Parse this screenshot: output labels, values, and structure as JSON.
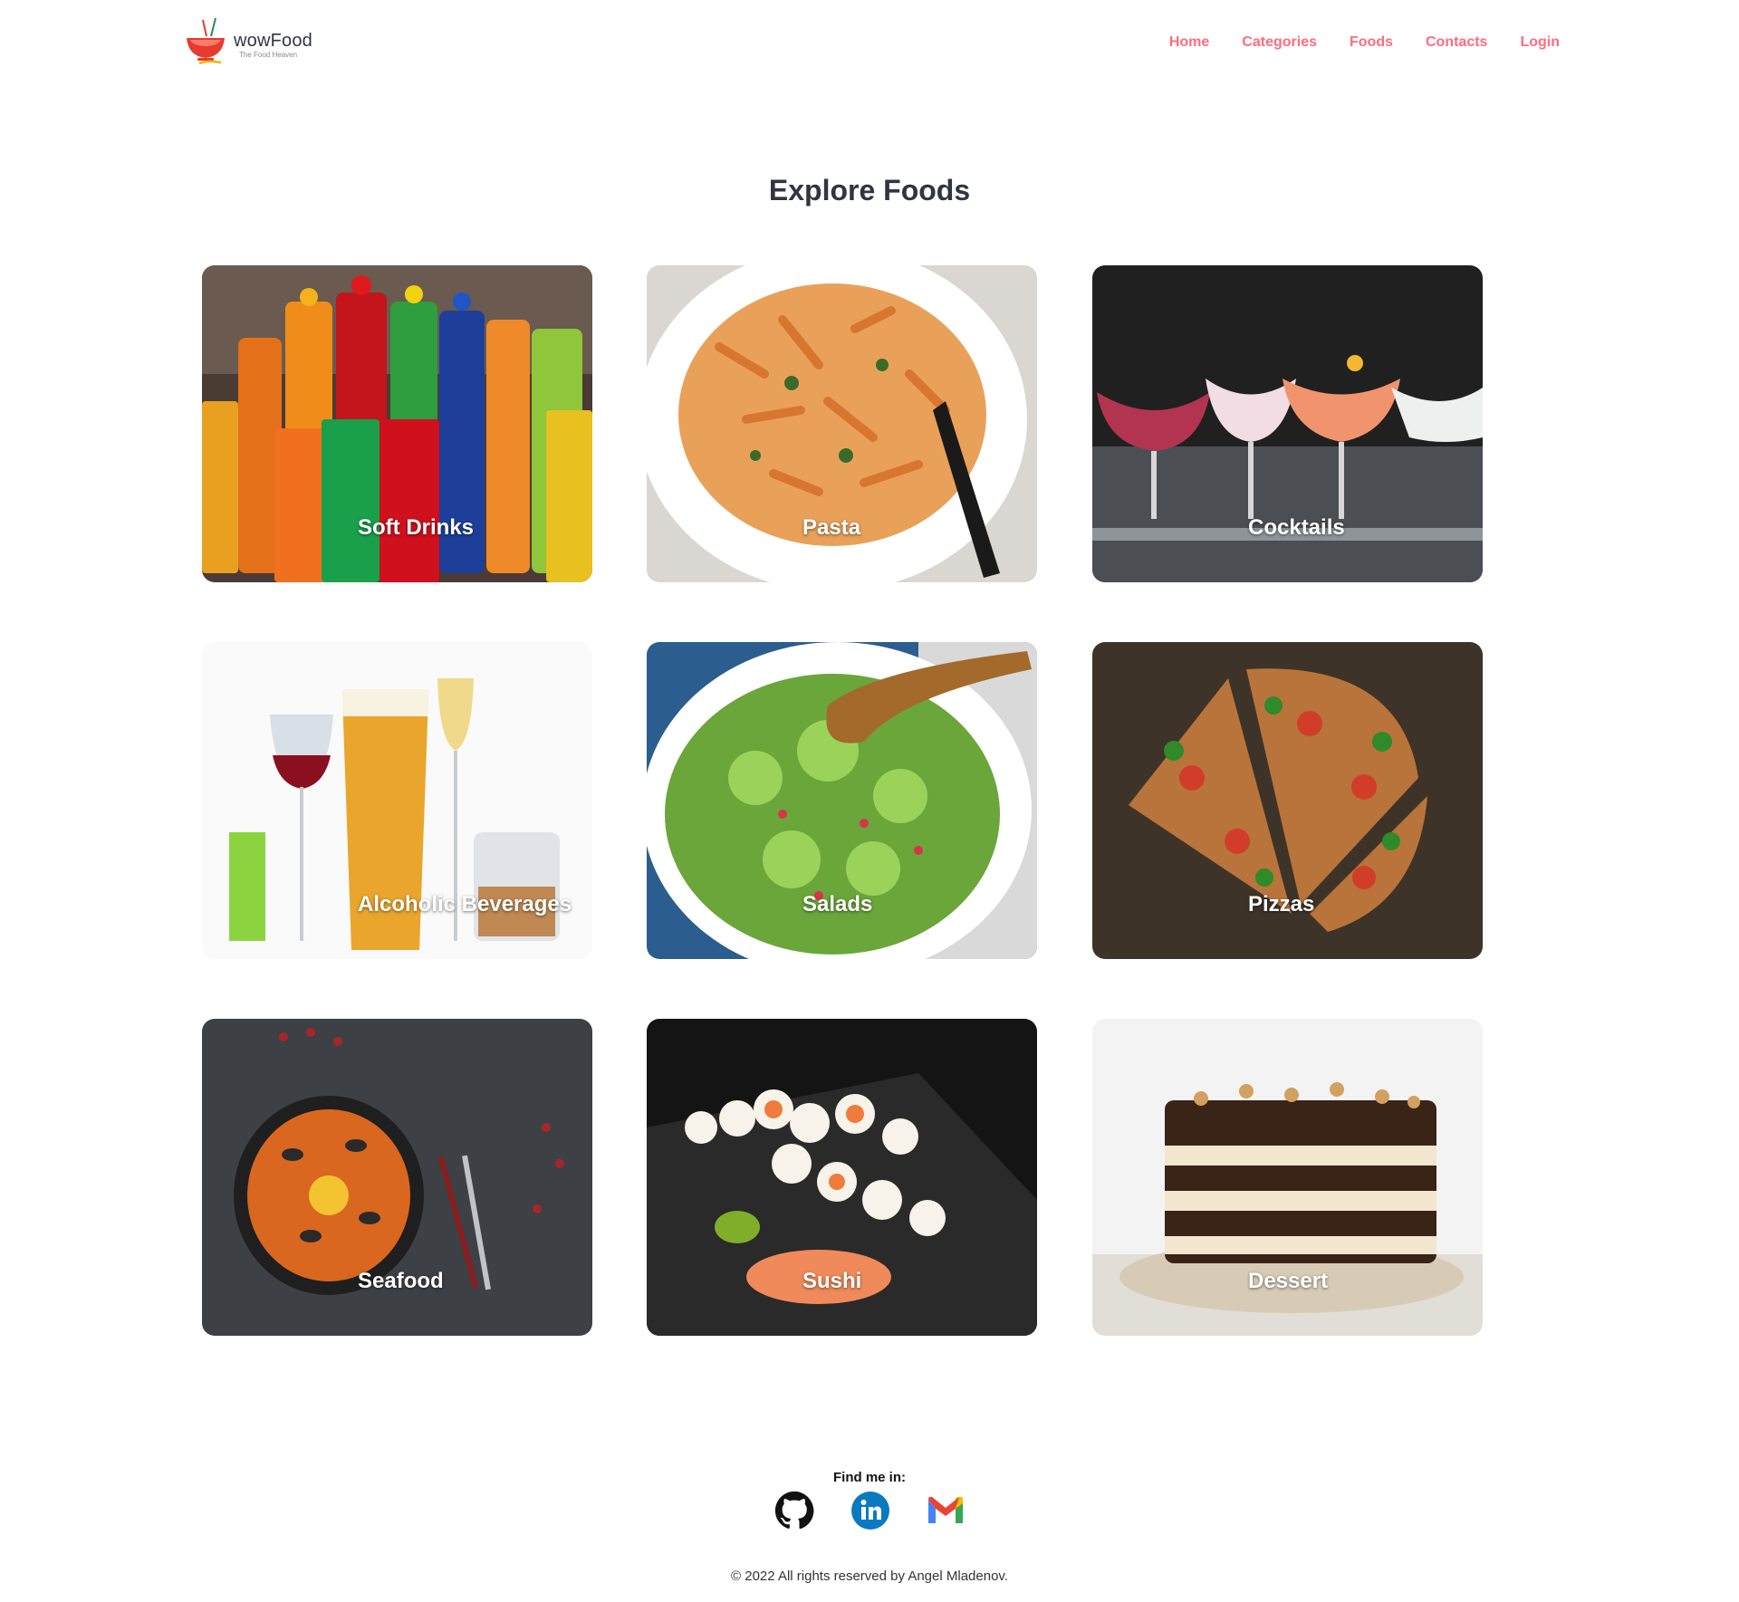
{
  "brand": {
    "name": "wowFood",
    "tagline": "The Food Heaven",
    "accent_color": "#ff6b81",
    "icon": "food-bowl-logo-icon"
  },
  "nav": {
    "items": [
      {
        "label": "Home"
      },
      {
        "label": "Categories"
      },
      {
        "label": "Foods"
      },
      {
        "label": "Contacts"
      },
      {
        "label": "Login"
      }
    ]
  },
  "main": {
    "title": "Explore Foods",
    "categories": [
      {
        "label": "Soft Drinks"
      },
      {
        "label": "Pasta"
      },
      {
        "label": "Cocktails"
      },
      {
        "label": "Alcoholic Beverages"
      },
      {
        "label": "Salads"
      },
      {
        "label": "Pizzas"
      },
      {
        "label": "Seafood"
      },
      {
        "label": "Sushi"
      },
      {
        "label": "Dessert"
      }
    ]
  },
  "footer": {
    "find_label": "Find me in:",
    "socials": [
      {
        "icon": "github-icon"
      },
      {
        "icon": "linkedin-icon"
      },
      {
        "icon": "gmail-icon"
      }
    ],
    "copyright": "© 2022 All rights reserved by Angel Mladenov."
  }
}
